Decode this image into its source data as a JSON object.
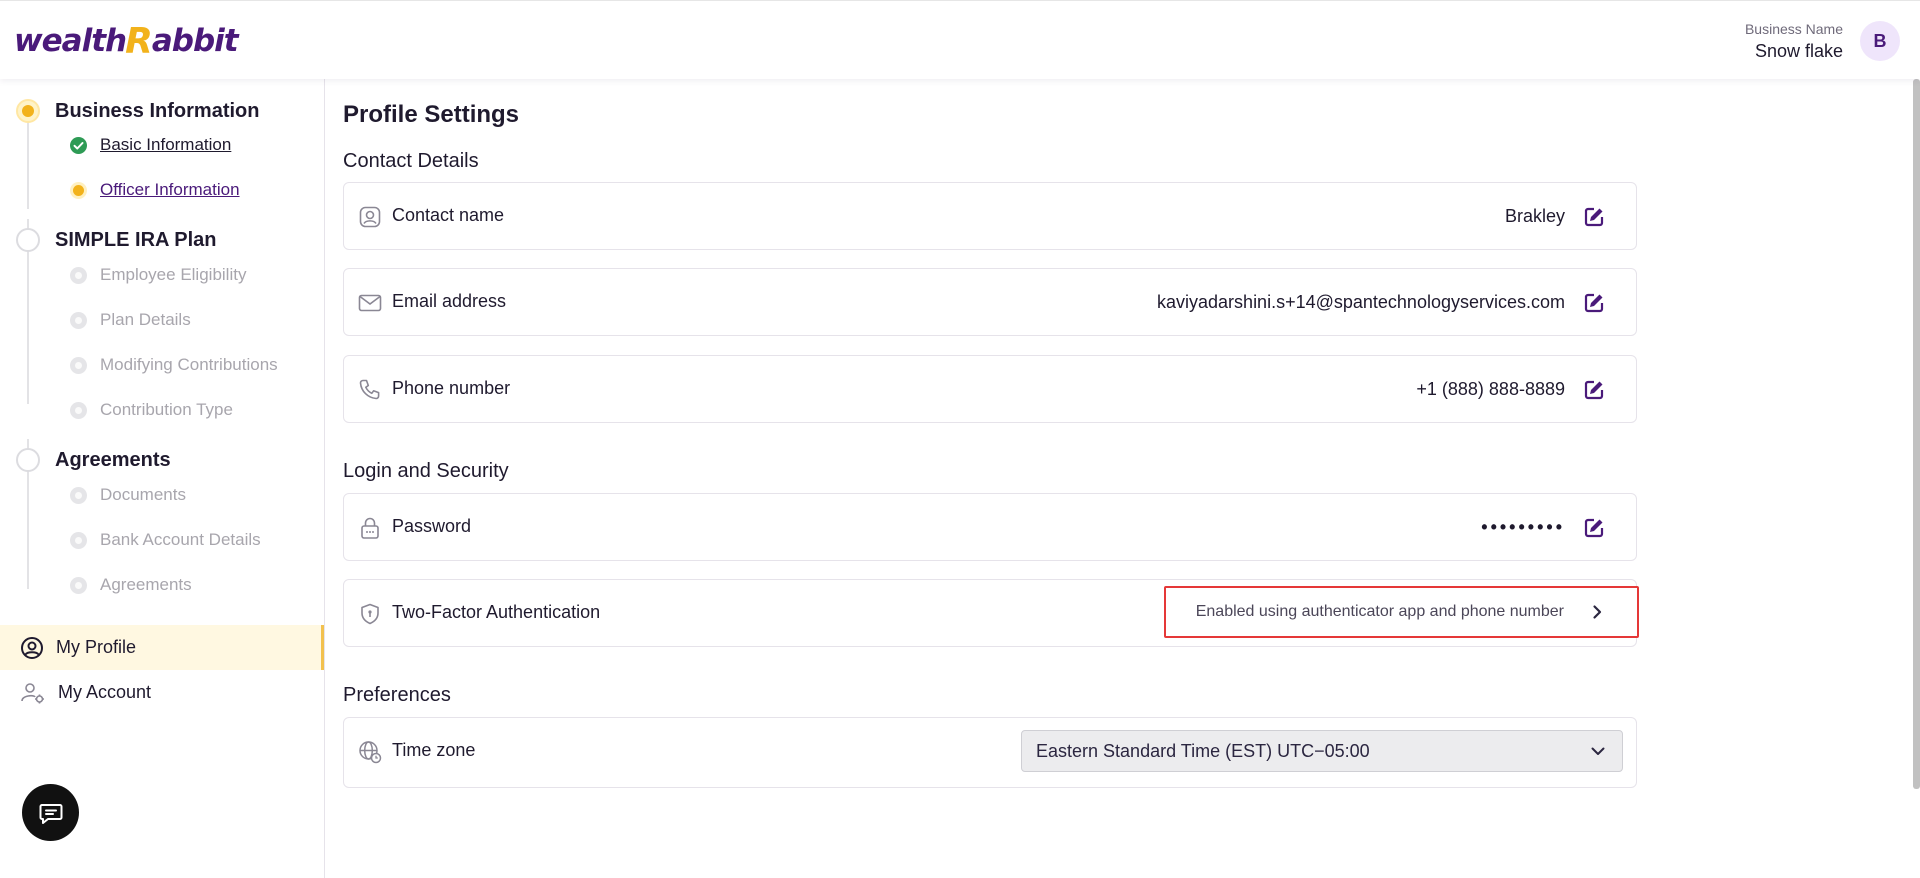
{
  "header": {
    "logo_part1": "wealth",
    "logo_part2": "R",
    "logo_part3": "abbit",
    "business_label": "Business Name",
    "business_name": "Snow flake",
    "avatar_initial": "B"
  },
  "sidebar": {
    "sections": [
      {
        "title": "Business Information",
        "status": "active",
        "items": [
          {
            "label": "Basic Information",
            "status": "done"
          },
          {
            "label": "Officer Information",
            "status": "current"
          }
        ]
      },
      {
        "title": "SIMPLE IRA Plan",
        "status": "pending",
        "items": [
          {
            "label": "Employee Eligibility",
            "status": "pending"
          },
          {
            "label": "Plan Details",
            "status": "pending"
          },
          {
            "label": "Modifying Contributions",
            "status": "pending"
          },
          {
            "label": "Contribution Type",
            "status": "pending"
          }
        ]
      },
      {
        "title": "Agreements",
        "status": "pending",
        "items": [
          {
            "label": "Documents",
            "status": "pending"
          },
          {
            "label": "Bank Account Details",
            "status": "pending"
          },
          {
            "label": "Agreements",
            "status": "pending"
          }
        ]
      }
    ],
    "nav": [
      {
        "label": "My Profile",
        "icon": "user-circle-icon",
        "selected": true
      },
      {
        "label": "My Account",
        "icon": "user-gear-icon",
        "selected": false
      }
    ],
    "chat_icon": "chat-icon"
  },
  "main": {
    "title": "Profile Settings",
    "contact": {
      "heading": "Contact Details",
      "rows": [
        {
          "label": "Contact name",
          "value": "Brakley",
          "icon": "user-icon"
        },
        {
          "label": "Email address",
          "value": "kaviyadarshini.s+14@spantechnologyservices.com",
          "icon": "mail-icon"
        },
        {
          "label": "Phone number",
          "value": "+1 (888) 888-8889",
          "icon": "phone-icon"
        }
      ]
    },
    "security": {
      "heading": "Login and Security",
      "password_label": "Password",
      "password_value": "•••••••••",
      "tfa_label": "Two-Factor Authentication",
      "tfa_status": "Enabled using authenticator app and phone number"
    },
    "preferences": {
      "heading": "Preferences",
      "timezone_label": "Time zone",
      "timezone_value": "Eastern Standard Time (EST) UTC−05:00"
    }
  },
  "colors": {
    "brand_purple": "#4a1a7a",
    "brand_yellow": "#f2b21b",
    "success_green": "#2e9b55",
    "highlight_red": "#e53838"
  }
}
